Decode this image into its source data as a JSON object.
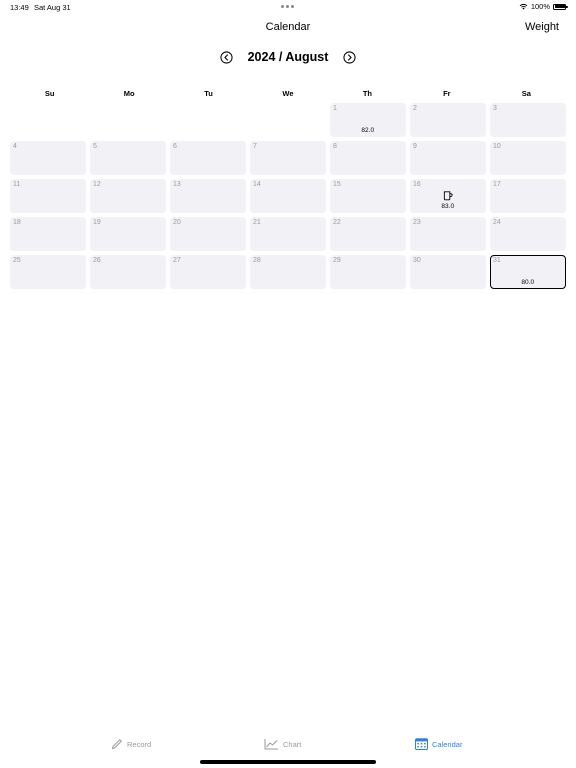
{
  "status": {
    "time": "13:49",
    "date": "Sat Aug 31",
    "battery": "100%",
    "icons": [
      "wifi-icon",
      "battery-icon"
    ]
  },
  "nav": {
    "title": "Calendar",
    "right_button": "Weight"
  },
  "month_header": {
    "label": "2024 / August",
    "prev_icon": "chevron-left-circle-icon",
    "next_icon": "chevron-right-circle-icon"
  },
  "weekdays": [
    "Su",
    "Mo",
    "Tu",
    "We",
    "Th",
    "Fr",
    "Sa"
  ],
  "calendar": {
    "leading_empty_days": 4,
    "days": [
      {
        "day": "1",
        "weight": "82.0"
      },
      {
        "day": "2"
      },
      {
        "day": "3"
      },
      {
        "day": "4"
      },
      {
        "day": "5"
      },
      {
        "day": "6"
      },
      {
        "day": "7"
      },
      {
        "day": "8"
      },
      {
        "day": "9"
      },
      {
        "day": "10"
      },
      {
        "day": "11"
      },
      {
        "day": "12"
      },
      {
        "day": "13"
      },
      {
        "day": "14"
      },
      {
        "day": "15"
      },
      {
        "day": "16",
        "weight": "83.0",
        "icon": "mug-icon"
      },
      {
        "day": "17"
      },
      {
        "day": "18"
      },
      {
        "day": "19"
      },
      {
        "day": "20"
      },
      {
        "day": "21"
      },
      {
        "day": "22"
      },
      {
        "day": "23"
      },
      {
        "day": "24"
      },
      {
        "day": "25"
      },
      {
        "day": "26"
      },
      {
        "day": "27"
      },
      {
        "day": "28"
      },
      {
        "day": "29"
      },
      {
        "day": "30"
      },
      {
        "day": "31",
        "weight": "80.0",
        "selected": true
      }
    ]
  },
  "tabs": [
    {
      "label": "Record",
      "icon": "pencil-icon",
      "active": false
    },
    {
      "label": "Chart",
      "icon": "line-chart-icon",
      "active": false
    },
    {
      "label": "Calendar",
      "icon": "calendar-icon",
      "active": true
    }
  ],
  "colors": {
    "accent": "#2f7fe6",
    "cell_bg": "#f2f2f6",
    "muted_text": "#9a9a9e"
  }
}
